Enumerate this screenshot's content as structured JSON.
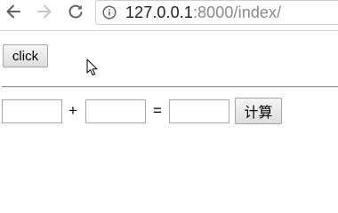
{
  "browser": {
    "url_host": "127.0.0.1",
    "url_rest": ":8000/index/",
    "icons": {
      "back": "arrow-left-icon",
      "forward": "arrow-right-icon",
      "reload": "reload-icon",
      "site_info": "info-circle-icon",
      "cursor": "mouse-pointer-icon"
    },
    "colors": {
      "icon_active": "#5f6368",
      "icon_disabled": "#c8c8c8",
      "url_host": "#202020",
      "url_rest": "#8a8a8a"
    }
  },
  "page": {
    "click_button_label": "click",
    "operand_a_value": "",
    "operand_b_value": "",
    "result_value": "",
    "plus_sign": "+",
    "equals_sign": "=",
    "calculate_button_label": "计算"
  }
}
